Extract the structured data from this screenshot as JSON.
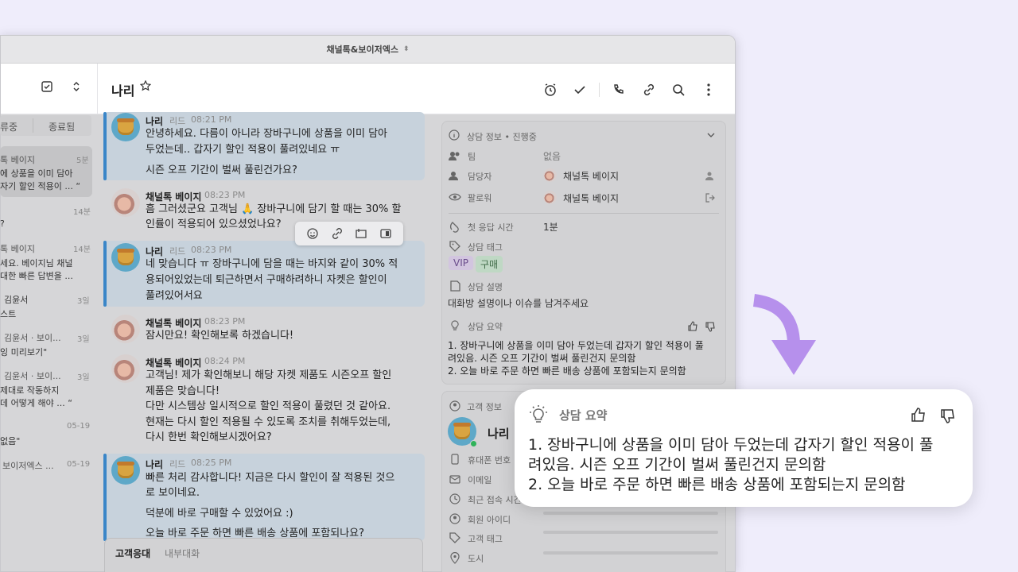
{
  "window": {
    "title": "채널톡&보이저엑스"
  },
  "header": {
    "title": "나리"
  },
  "sidebar": {
    "tabs": [
      "류중",
      "종료됨"
    ],
    "items": [
      {
        "name": "톡 베이지",
        "date": "5분",
        "lines": [
          "에 상품을 이미 담아",
          "자기 할인 적용이 ... “"
        ]
      },
      {
        "name": "",
        "date": "14분",
        "lines": [
          "?"
        ]
      },
      {
        "name": "톡 베이지",
        "date": "14분",
        "lines": [
          "세요. 베이지님 채널",
          "대한 빠른 답변을 ..."
        ]
      },
      {
        "name": "김윤서",
        "date": "3일",
        "lines": [
          "스트"
        ]
      },
      {
        "name": "김윤서 · 보이...",
        "date": "3일",
        "lines": [
          "잉 미리보기\""
        ]
      },
      {
        "name": "김윤서 · 보이...",
        "date": "3일",
        "lines": [
          "제대로 작동하지",
          "데 어떻게 해야 ... “"
        ]
      },
      {
        "name": "",
        "date": "05-19",
        "lines": [
          "없음\""
        ]
      },
      {
        "name": "보이저엑스 ...",
        "date": "05-19",
        "lines": []
      }
    ]
  },
  "messages": [
    {
      "sender": "나리",
      "role": "리드",
      "time": "08:21 PM",
      "lines": [
        "안녕하세요. 다름이 아니라 장바구니에 상품을 이미 담아",
        "두었는데.. 갑자기 할인 적용이 풀려있네요 ㅠ",
        "",
        "시즌 오프 기간이 벌써 풀린건가요?"
      ]
    },
    {
      "sender": "채널톡 베이지",
      "role": "",
      "time": "08:23 PM",
      "lines": [
        "흠 그러셨군요 고객님 🙏 장바구니에 담기 할 때는 30% 할",
        "인률이 적용되어 있으셨었나요?"
      ]
    },
    {
      "sender": "나리",
      "role": "리드",
      "time": "08:23 PM",
      "lines": [
        "네 맞습니다 ㅠ 장바구니에 담을 때는 바지와 같이 30% 적",
        "용되어있었는데 퇴근하면서 구매하려하니 자켓은 할인이",
        "풀려있어서요"
      ]
    },
    {
      "sender": "채널톡 베이지",
      "role": "",
      "time": "08:23 PM",
      "lines": [
        "잠시만요! 확인해보록 하겠습니다!"
      ]
    },
    {
      "sender": "채널톡 베이지",
      "role": "",
      "time": "08:24 PM",
      "lines": [
        "고객님! 제가 확인해보니 해당 자켓 제품도 시즌오프 할인",
        "제품은 맞습니다!",
        "다만 시스템상 일시적으로 할인 적용이 풀렸던 것 같아요.",
        "현재는 다시 할인 적용될 수 있도록 조치를 취해두었는데,",
        "다시 한번 확인해보시겠어요?"
      ]
    },
    {
      "sender": "나리",
      "role": "리드",
      "time": "08:25 PM",
      "lines": [
        "빠른 처리 감사합니다! 지금은 다시 할인이 잘 적용된 것으",
        "로 보이네요.",
        "",
        "덕분에 바로 구매할 수 있었어요 :)",
        "",
        "오늘 바로 주문 하면 빠른 배송 상품에 포함되나요?"
      ]
    }
  ],
  "composer": {
    "tab_customer": "고객응대",
    "tab_internal": "내부대화"
  },
  "info": {
    "title": "상담 정보 • 진행중",
    "team_label": "팀",
    "team_value": "없음",
    "assignee_label": "담당자",
    "assignee_value": "채널톡 베이지",
    "follower_label": "팔로워",
    "follower_value": "채널톡 베이지",
    "first_response_label": "첫 응답 시간",
    "first_response_value": "1분",
    "tags_label": "상담 태그",
    "tags": [
      "VIP",
      "구매"
    ],
    "desc_label": "상담 설명",
    "desc_value": "대화방 설명이나 이슈를 남겨주세요",
    "summary_label": "상담 요약",
    "summary_lines": [
      "1. 장바구니에 상품을 이미 담아 두었는데 갑자기 할인 적용이 풀",
      "려있음. 시즌 오프 기간이 벌써 풀린건지 문의함",
      "2. 오늘 바로 주문 하면 빠른 배송 상품에 포함되는지 문의함"
    ]
  },
  "customer": {
    "title": "고객 정보",
    "name": "나리",
    "fields": [
      "휴대폰 번호",
      "이메일",
      "최근 접속 시간",
      "회원 아이디",
      "고객 태그",
      "도시"
    ]
  },
  "popup": {
    "title": "상담 요약",
    "lines": [
      "1. 장바구니에 상품을 이미 담아 두었는데 갑자기 할인 적용이 풀",
      "려있음. 시즌 오프 기간이 벌써 풀린건지 문의함",
      "2. 오늘 바로 주문 하면 빠른 배송 상품에 포함되는지 문의함"
    ]
  },
  "colors": {
    "accent": "#3a86c8",
    "arrow": "#b690ec",
    "vip_tag": "#d9c8ea",
    "buy_tag": "#c8e0cc"
  }
}
